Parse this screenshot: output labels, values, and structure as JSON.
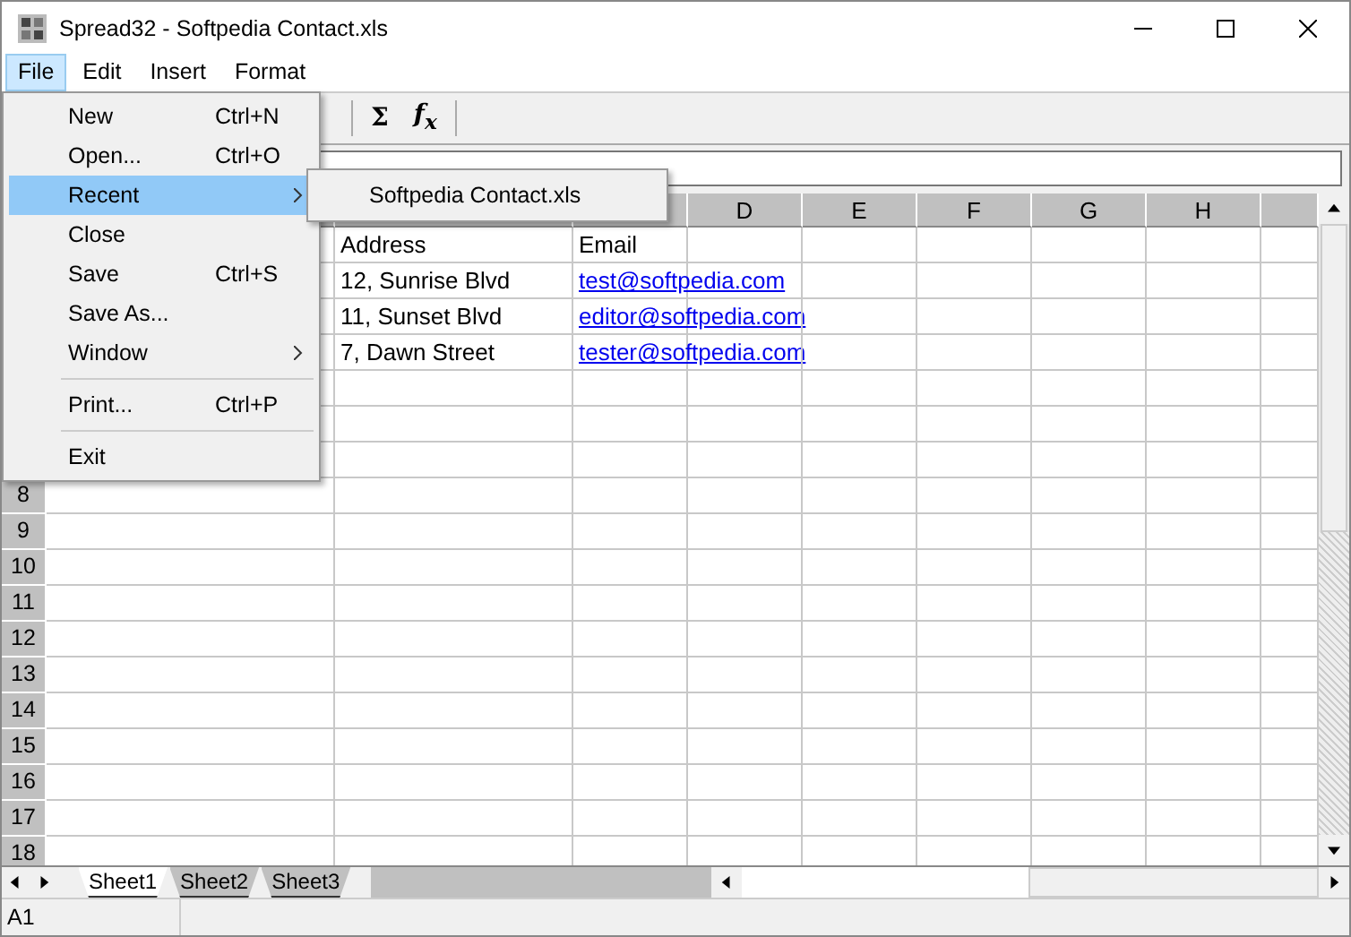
{
  "window": {
    "title": "Spread32 - Softpedia Contact.xls"
  },
  "menubar": [
    {
      "label": "File",
      "selected": true
    },
    {
      "label": "Edit",
      "selected": false
    },
    {
      "label": "Insert",
      "selected": false
    },
    {
      "label": "Format",
      "selected": false
    }
  ],
  "file_menu": [
    {
      "kind": "item",
      "label": "New",
      "shortcut": "Ctrl+N",
      "selected": false
    },
    {
      "kind": "item",
      "label": "Open...",
      "shortcut": "Ctrl+O",
      "selected": false
    },
    {
      "kind": "submenu",
      "label": "Recent",
      "selected": true
    },
    {
      "kind": "item",
      "label": "Close",
      "selected": false
    },
    {
      "kind": "item",
      "label": "Save",
      "shortcut": "Ctrl+S",
      "selected": false
    },
    {
      "kind": "item",
      "label": "Save As...",
      "selected": false
    },
    {
      "kind": "submenu",
      "label": "Window",
      "selected": false
    },
    {
      "kind": "separator"
    },
    {
      "kind": "item",
      "label": "Print...",
      "shortcut": "Ctrl+P",
      "selected": false
    },
    {
      "kind": "separator"
    },
    {
      "kind": "item",
      "label": "Exit",
      "selected": false
    }
  ],
  "recent_submenu": [
    "Softpedia Contact.xls"
  ],
  "toolbar": [
    {
      "kind": "sum",
      "label": "Σ"
    },
    {
      "kind": "function",
      "label": "f$_{x}$"
    }
  ],
  "column_headers": [
    "D",
    "E",
    "F",
    "G",
    "H"
  ],
  "rows": [
    {
      "cells": [
        {
          "kind": "text",
          "text": "Address"
        },
        {
          "kind": "text",
          "text": "Email"
        }
      ]
    },
    {
      "cells": [
        {
          "kind": "text",
          "text": "12, Sunrise Blvd"
        },
        {
          "kind": "link",
          "text": "test@softpedia.com"
        }
      ]
    },
    {
      "cells": [
        {
          "kind": "text",
          "text": "11, Sunset Blvd"
        },
        {
          "kind": "link",
          "text": "editor@softpedia.com"
        }
      ]
    },
    {
      "cells": [
        {
          "kind": "text",
          "text": "7, Dawn Street"
        },
        {
          "kind": "link",
          "text": "tester@softpedia.com"
        }
      ]
    },
    {
      "cells": []
    },
    {
      "cells": []
    },
    {
      "cells": []
    },
    {
      "number": "8",
      "cells": []
    },
    {
      "number": "9",
      "cells": []
    },
    {
      "number": "10",
      "cells": []
    },
    {
      "number": "11",
      "cells": []
    },
    {
      "number": "12",
      "cells": []
    },
    {
      "number": "13",
      "cells": []
    },
    {
      "number": "14",
      "cells": []
    },
    {
      "number": "15",
      "cells": []
    },
    {
      "number": "16",
      "cells": []
    },
    {
      "number": "17",
      "cells": []
    },
    {
      "number": "18",
      "cells": []
    }
  ],
  "sheet_tabs": [
    {
      "label": "Sheet1",
      "selected": true
    },
    {
      "label": "Sheet2",
      "selected": false
    },
    {
      "label": "Sheet3",
      "selected": false
    }
  ],
  "status_bar": {
    "cell": "A1"
  }
}
